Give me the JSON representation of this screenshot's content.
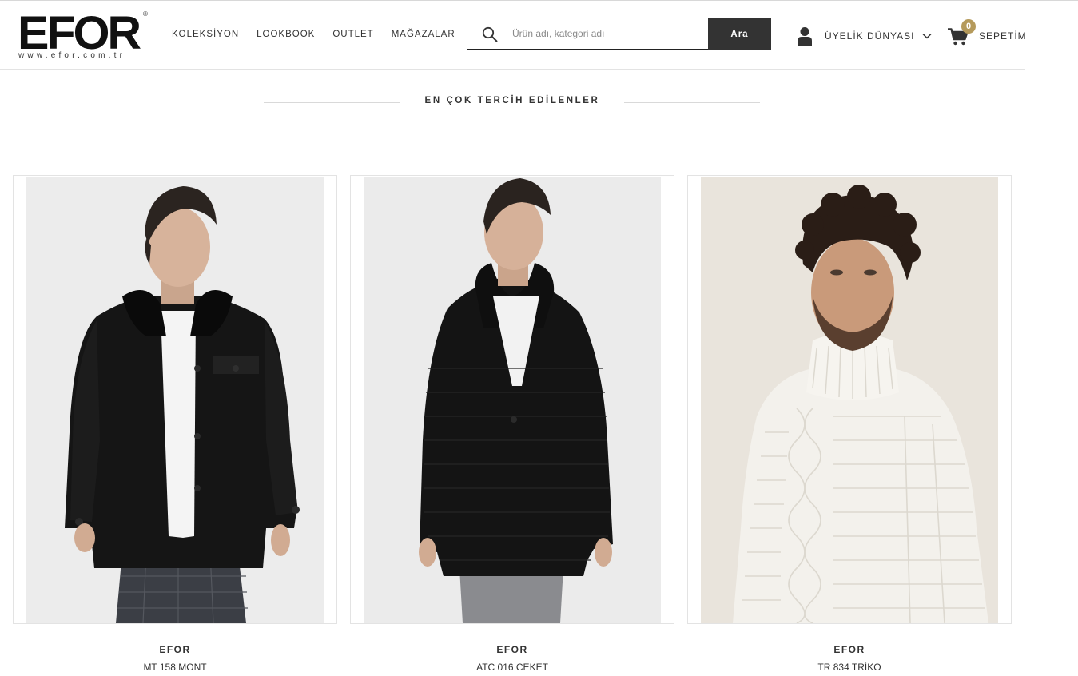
{
  "header": {
    "logo": {
      "wordmark": "EFOR",
      "registered": "®",
      "url": "www.efor.com.tr"
    },
    "nav": [
      {
        "label": "KOLEKSİYON"
      },
      {
        "label": "LOOKBOOK"
      },
      {
        "label": "OUTLET"
      },
      {
        "label": "MAĞAZALAR"
      }
    ],
    "search": {
      "placeholder": "Ürün adı, kategori adı",
      "button_label": "Ara"
    },
    "account": {
      "label": "ÜYELİK DÜNYASI"
    },
    "cart": {
      "label": "SEPETİM",
      "count": "0"
    }
  },
  "section": {
    "title": "EN ÇOK TERCİH EDİLENLER"
  },
  "products": [
    {
      "brand": "EFOR",
      "name": "MT 158 MONT",
      "garment_color": "#151515",
      "background": "#ececec"
    },
    {
      "brand": "EFOR",
      "name": "ATC 016 CEKET",
      "garment_color": "#141414",
      "background": "#ebebeb"
    },
    {
      "brand": "EFOR",
      "name": "TR 834 TRİKO",
      "garment_color": "#f3f1ec",
      "background": "#e9e4dc"
    }
  ],
  "colors": {
    "accent": "#b59a5b",
    "button": "#333333",
    "text": "#333333"
  }
}
